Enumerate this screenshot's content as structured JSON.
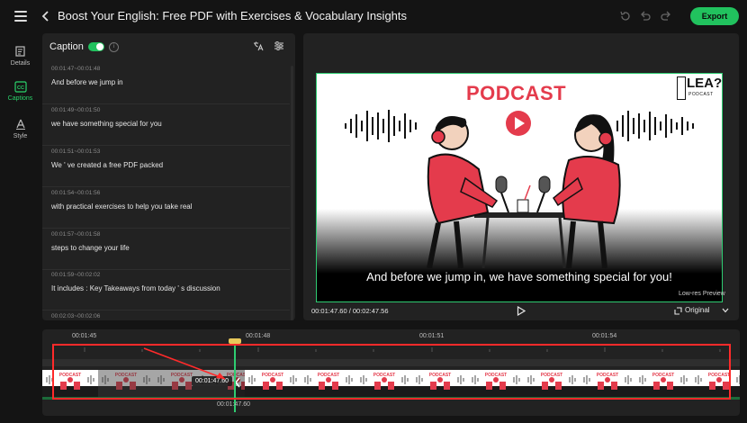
{
  "header": {
    "title": "Boost Your English: Free PDF with Exercises & Vocabulary Insights",
    "export_label": "Export"
  },
  "rail": {
    "items": [
      {
        "label": "Details",
        "icon": "details-icon"
      },
      {
        "label": "Captions",
        "icon": "cc-icon",
        "active": true
      },
      {
        "label": "Style",
        "icon": "style-icon"
      }
    ]
  },
  "caption_panel": {
    "title": "Caption",
    "toggle_on": true,
    "items": [
      {
        "time": "00:01:47~00:01:48",
        "text": "And before we jump in"
      },
      {
        "time": "00:01:49~00:01:50",
        "text": "we have something special for you"
      },
      {
        "time": "00:01:51~00:01:53",
        "text": "We ' ve created a free PDF packed"
      },
      {
        "time": "00:01:54~00:01:56",
        "text": "with practical exercises to help you take real"
      },
      {
        "time": "00:01:57~00:01:58",
        "text": "steps to change your life"
      },
      {
        "time": "00:01:59~00:02:02",
        "text": "It includes : Key Takeaways from today ' s discussion"
      },
      {
        "time": "00:02:03~00:02:06",
        "text": ""
      }
    ]
  },
  "preview": {
    "video_heading": "PODCAST",
    "logo_text": "LEA?",
    "logo_sub": "PODCAST",
    "caption_overlay": "And before we jump in, we have something special for you!",
    "low_res_label": "Low-res Preview",
    "time_readout": "00:01:47.60 / 00:02:47.56",
    "aspect_label": "Original"
  },
  "timeline": {
    "ticks": [
      "00:01:45",
      "00:01:48",
      "00:01:51",
      "00:01:54"
    ],
    "playhead_time": "00:01:47.60",
    "playhead_time_below": "00:01:47.60"
  },
  "colors": {
    "accent": "#21c25e",
    "highlight_box": "#ff2a2a",
    "brand_red": "#e43b4c"
  }
}
